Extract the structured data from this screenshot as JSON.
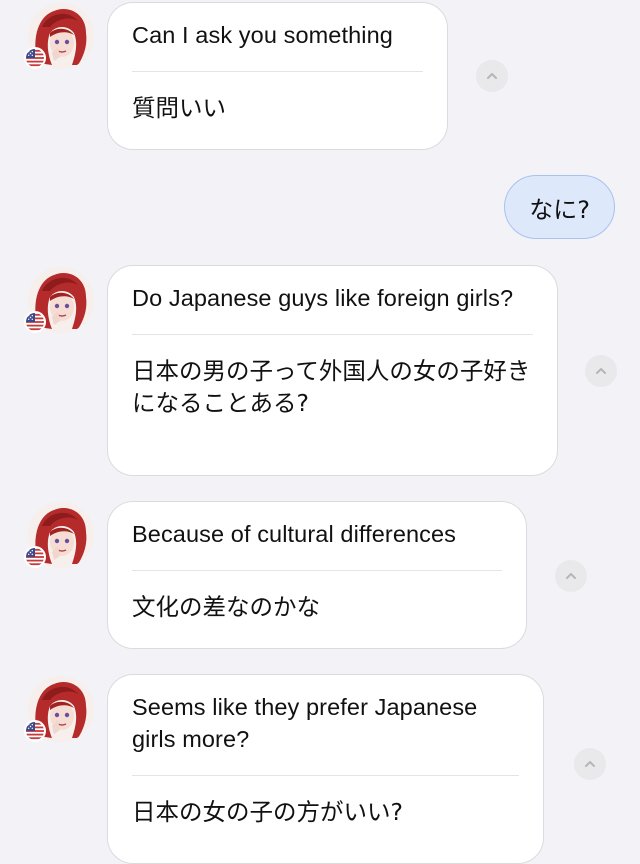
{
  "messages": [
    {
      "original": "Can I ask you something",
      "translation": "質問いい"
    },
    {
      "original": "Do Japanese guys like foreign girls?",
      "translation": "日本の男の子って外国人の女の子好きになることある?"
    },
    {
      "original": "Because of cultural differences",
      "translation": "文化の差なのかな"
    },
    {
      "original": "Seems like they prefer Japanese girls more?",
      "translation": "日本の女の子の方がいい?"
    }
  ],
  "sent_message": {
    "text": "なに?"
  },
  "icons": {
    "avatar": "avatar-icon",
    "flag": "us-flag-icon",
    "toggle": "chevron-up-icon"
  },
  "colors": {
    "background": "#f2f2f7",
    "sent_bubble": "#dde8fb",
    "sent_border": "#a9c2ee",
    "received_bubble": "#ffffff"
  }
}
